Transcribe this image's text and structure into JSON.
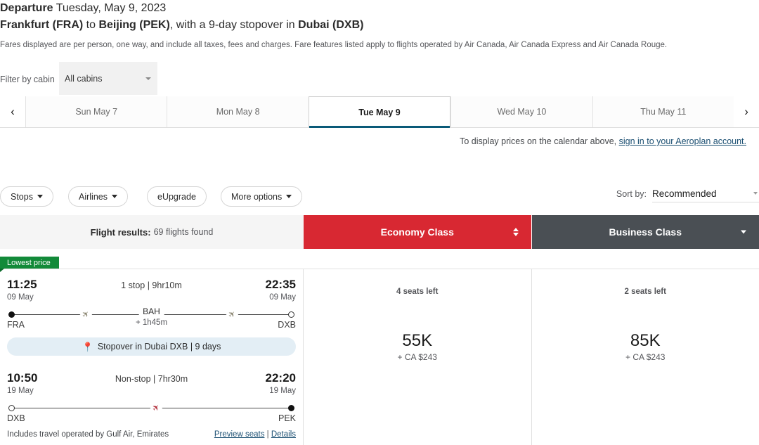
{
  "header": {
    "departure_label": "Departure",
    "departure_date": "Tuesday, May 9, 2023",
    "origin": "Frankfurt (FRA)",
    "to_word": "to",
    "destination": "Beijing (PEK)",
    "stopover_phrase": ", with a 9-day stopover in ",
    "stopover_city": "Dubai (DXB)",
    "fare_note": "Fares displayed are per person, one way, and include all taxes, fees and charges. Fare features listed apply to flights operated by Air Canada, Air Canada Express and Air Canada Rouge."
  },
  "cabin_filter": {
    "label": "Filter by cabin",
    "selected": "All cabins",
    "options": [
      "All cabins"
    ]
  },
  "date_tabs": {
    "prev_label": "‹",
    "next_label": "›",
    "items": [
      {
        "label": "Sun May 7",
        "active": false
      },
      {
        "label": "Mon May 8",
        "active": false
      },
      {
        "label": "Tue May 9",
        "active": true
      },
      {
        "label": "Wed May 10",
        "active": false
      },
      {
        "label": "Thu May 11",
        "active": false
      }
    ]
  },
  "signin": {
    "text": "To display prices on the calendar above, ",
    "link": "sign in to your Aeroplan account."
  },
  "filters": {
    "stops": "Stops",
    "airlines": "Airlines",
    "eupgrade": "eUpgrade",
    "more_options": "More options"
  },
  "sort": {
    "label": "Sort by:",
    "value": "Recommended"
  },
  "results_bar": {
    "results_label": "Flight results:",
    "results_count": "69 flights found",
    "economy_label": "Economy Class",
    "business_label": "Business Class"
  },
  "badge": {
    "lowest_price": "Lowest price"
  },
  "flight": {
    "segments": [
      {
        "depart_time": "11:25",
        "depart_date": "09 May",
        "middle": "1 stop | 9hr10m",
        "arrive_time": "22:35",
        "arrive_date": "09 May",
        "origin_code": "FRA",
        "destination_code": "DXB",
        "stop_code": "BAH",
        "layover": "+ 1h45m"
      },
      {
        "depart_time": "10:50",
        "depart_date": "19 May",
        "middle": "Non-stop | 7hr30m",
        "arrive_time": "22:20",
        "arrive_date": "19 May",
        "origin_code": "DXB",
        "destination_code": "PEK",
        "stop_code": "",
        "layover": ""
      }
    ],
    "stopover_banner": "Stopover in Dubai DXB | 9 days",
    "operated_by": "Includes travel operated by Gulf Air, Emirates",
    "preview_seats": "Preview seats",
    "links_separator": " | ",
    "details": "Details",
    "economy": {
      "seats_left": "4 seats left",
      "points": "55K",
      "cash": "+ CA $243"
    },
    "business": {
      "seats_left": "2 seats left",
      "points": "85K",
      "cash": "+ CA $243"
    }
  },
  "colors": {
    "economy_red": "#d82832",
    "business_gray": "#4a4f54",
    "badge_green": "#128a39",
    "active_tab_underline": "#0a5a78",
    "link_blue": "#1b4f72",
    "stopover_bg": "#e3eef5"
  }
}
